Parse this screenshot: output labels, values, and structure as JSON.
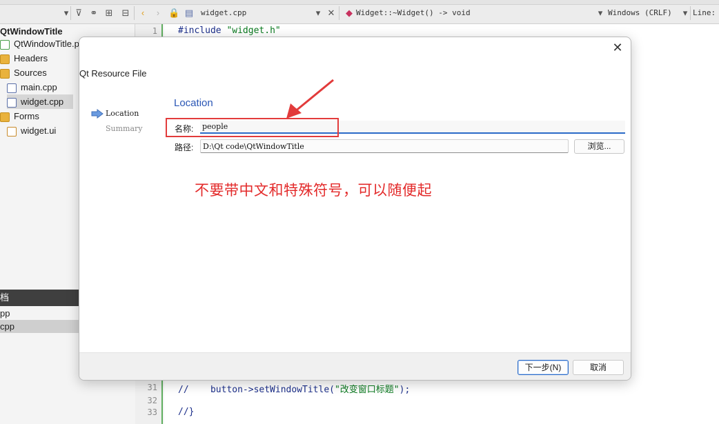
{
  "toolbar": {
    "file_tab": "widget.cpp",
    "function_crumb": "Widget::~Widget() -> void",
    "line_ending": "Windows (CRLF)",
    "line_label": "Line:"
  },
  "project_tree": {
    "project": "QtWindowTitle",
    "items": [
      {
        "label": "QtWindowTitle.pr",
        "icon": "qt-project-file-icon"
      },
      {
        "label": "Headers",
        "icon": "folder-icon"
      },
      {
        "label": "Sources",
        "icon": "folder-icon"
      },
      {
        "label": "main.cpp",
        "icon": "cpp-file-icon"
      },
      {
        "label": "widget.cpp",
        "icon": "cpp-file-icon",
        "selected": true
      },
      {
        "label": "Forms",
        "icon": "folder-icon"
      },
      {
        "label": "widget.ui",
        "icon": "ui-file-icon"
      }
    ]
  },
  "open_documents": {
    "header": "档",
    "items": [
      "pp",
      "cpp"
    ]
  },
  "editor": {
    "lines": [
      {
        "no": "1",
        "code": "#include ",
        "str": "\"widget.h\""
      },
      {
        "no": "31",
        "code": "//    button->setWindowTitle(",
        "str": "\"改变窗口标题\"",
        "tail": ");"
      },
      {
        "no": "32",
        "code": ""
      },
      {
        "no": "33",
        "code": "//}"
      }
    ]
  },
  "dialog": {
    "title": "Qt Resource File",
    "steps": [
      {
        "label": "Location",
        "active": true
      },
      {
        "label": "Summary",
        "active": false
      }
    ],
    "section_title": "Location",
    "name_label": "名称:",
    "name_value": "people",
    "path_label": "路径:",
    "path_value": "D:\\Qt code\\QtWindowTitle",
    "browse_label": "浏览...",
    "annotation": "不要带中文和特殊符号，可以随便起",
    "next_label": "下一步(N)",
    "cancel_label": "取消",
    "close_glyph": "✕"
  },
  "colors": {
    "accent": "#2a6ac8",
    "annotation": "#e23b3b",
    "section_title": "#2a56b5"
  }
}
